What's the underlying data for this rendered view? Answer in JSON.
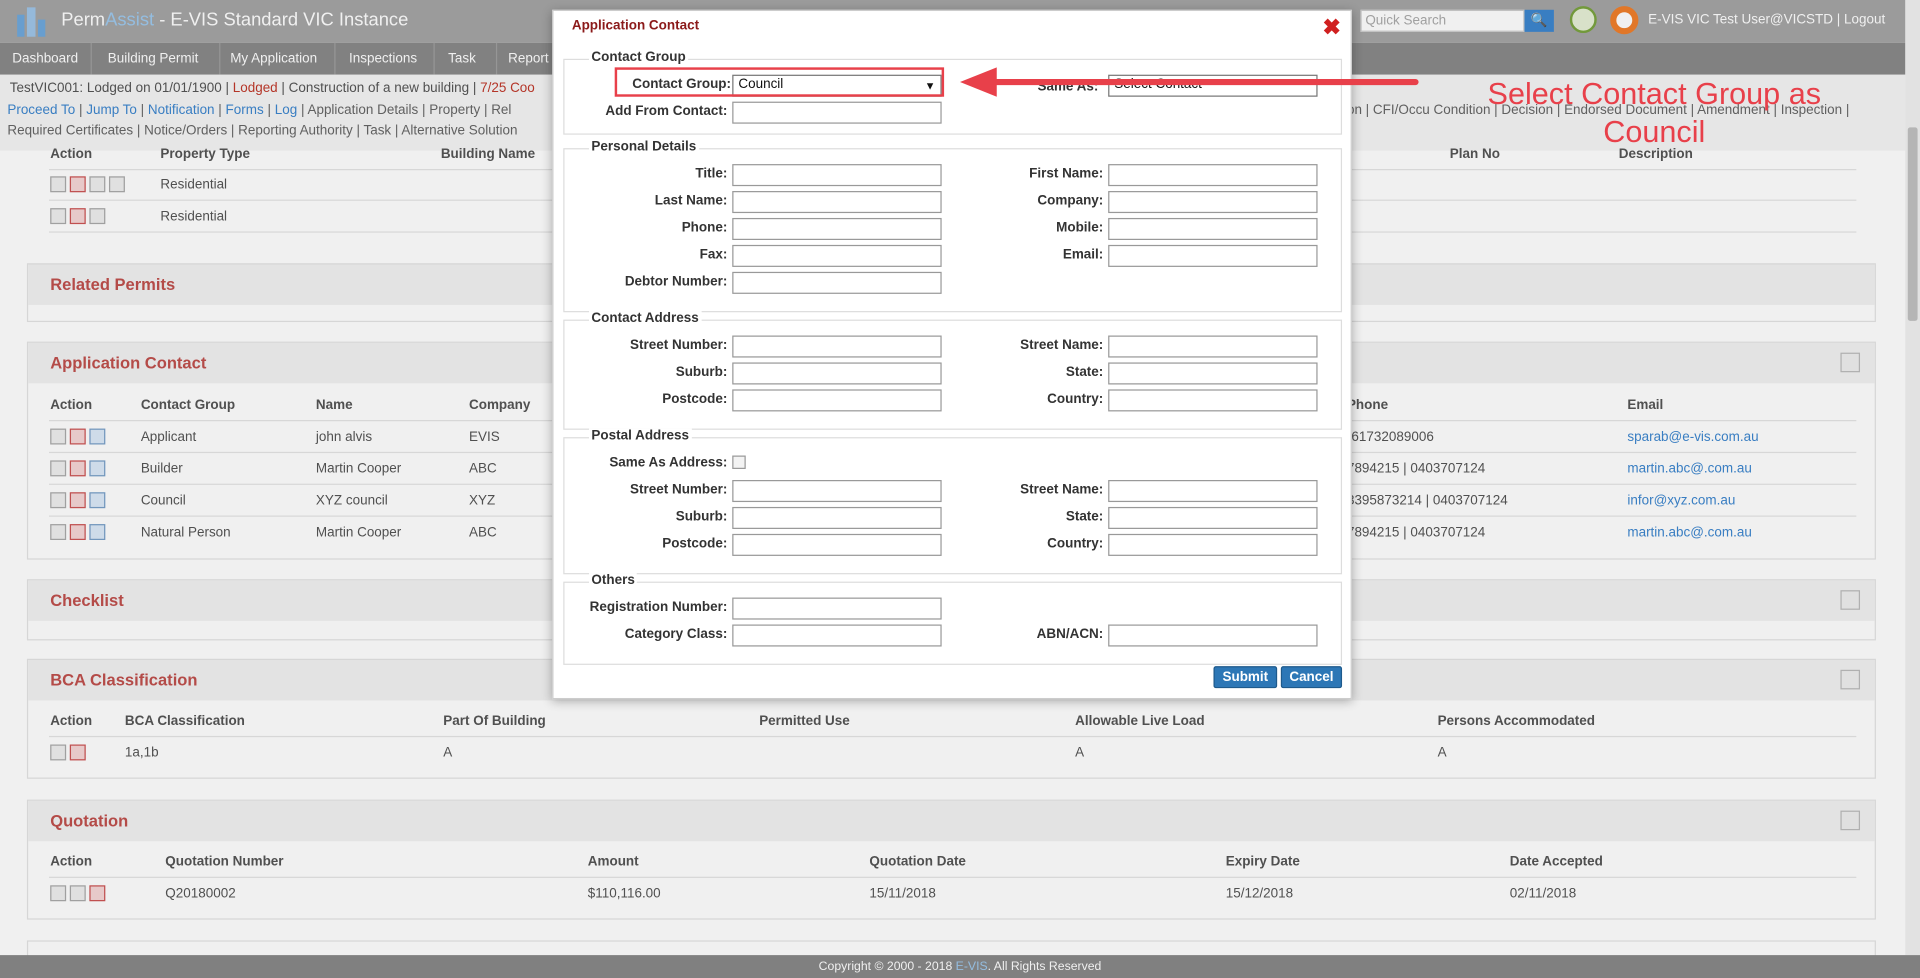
{
  "app": {
    "brand_perm": "Perm",
    "brand_assist": "Assist",
    "title": " - E-VIS Standard VIC Instance"
  },
  "search": {
    "placeholder": "Quick Search",
    "button": "🔍"
  },
  "user": {
    "name": "E-VIS VIC Test User@VICSTD",
    "separator": "|",
    "logout": "Logout"
  },
  "nav": [
    "Dashboard",
    "Building Permit ▸",
    "My Application",
    "Inspections",
    "Task",
    "Report"
  ],
  "info": {
    "line1_a": "TestVIC001: Lodged on 01/01/1900 | ",
    "line1_status": "Lodged",
    "line1_b": " | Construction of a new building | ",
    "line1_c": "7/25 Coo",
    "links": [
      "Proceed To",
      "Jump To",
      "Notification",
      "Forms",
      "Log"
    ],
    "plain": [
      "Application Details",
      "Property",
      "Rel"
    ],
    "right": "on | CFI/Occu Condition | Decision | Endorsed Document | Amendment | Inspection |",
    "line3": "Required Certificates | Notice/Orders | Reporting Authority | Task | Alternative Solution"
  },
  "property_table": {
    "headers": [
      "Action",
      "Property Type",
      "Building Name",
      "Plan No",
      "Description"
    ],
    "rows": [
      [
        "Residential"
      ],
      [
        "Residential"
      ]
    ]
  },
  "sections": {
    "related_permits": "Related Permits",
    "application_contact": "Application Contact",
    "checklist": "Checklist",
    "bca": "BCA Classification",
    "quotation": "Quotation"
  },
  "contacts": {
    "headers": [
      "Action",
      "Contact Group",
      "Name",
      "Company",
      "Phone",
      "Email"
    ],
    "rows": [
      {
        "group": "Applicant",
        "name": "john alvis",
        "company": "EVIS",
        "phone": "-61732089006",
        "email": "sparab@e-vis.com.au"
      },
      {
        "group": "Builder",
        "name": "Martin Cooper",
        "company": "ABC",
        "phone": "7894215 | 0403707124",
        "email": "martin.abc@.com.au"
      },
      {
        "group": "Council",
        "name": "XYZ council",
        "company": "XYZ",
        "phone": "3395873214 | 0403707124",
        "email": "infor@xyz.com.au"
      },
      {
        "group": "Natural Person",
        "name": "Martin Cooper",
        "company": "ABC",
        "phone": "7894215 | 0403707124",
        "email": "martin.abc@.com.au"
      }
    ]
  },
  "bca_table": {
    "headers": [
      "Action",
      "BCA Classification",
      "Part Of Building",
      "Permitted Use",
      "Allowable Live Load",
      "Persons Accommodated"
    ],
    "row": [
      "1a,1b",
      "A",
      "",
      "A",
      "A"
    ]
  },
  "quotation_table": {
    "headers": [
      "Action",
      "Quotation Number",
      "Amount",
      "Quotation Date",
      "Expiry Date",
      "Date Accepted"
    ],
    "row": [
      "Q20180002",
      "$110,116.00",
      "15/11/2018",
      "15/12/2018",
      "02/11/2018"
    ]
  },
  "footer": {
    "a": "Copyright © 2000 - 2018 ",
    "b": "E-VIS",
    "c": ". All Rights Reserved"
  },
  "modal": {
    "title": "Application Contact",
    "close": "✖",
    "contact_group": {
      "legend": "Contact Group",
      "label": "Contact Group:",
      "value": "Council",
      "same_as_label": "Same As:",
      "same_as_value": "Select Contact",
      "add_from_label": "Add From Contact:"
    },
    "personal": {
      "legend": "Personal Details",
      "title": "Title:",
      "first_name": "First Name:",
      "last_name": "Last Name:",
      "company": "Company:",
      "phone": "Phone:",
      "mobile": "Mobile:",
      "fax": "Fax:",
      "email": "Email:",
      "debtor": "Debtor Number:"
    },
    "address": {
      "legend": "Contact Address",
      "street_number": "Street Number:",
      "street_name": "Street Name:",
      "suburb": "Suburb:",
      "state": "State:",
      "postcode": "Postcode:",
      "country": "Country:"
    },
    "postal": {
      "legend": "Postal Address",
      "same_as_address": "Same As Address:",
      "street_number": "Street Number:",
      "street_name": "Street Name:",
      "suburb": "Suburb:",
      "state": "State:",
      "postcode": "Postcode:",
      "country": "Country:"
    },
    "others": {
      "legend": "Others",
      "registration": "Registration Number:",
      "category": "Category Class:",
      "abn": "ABN/ACN:"
    },
    "submit": "Submit",
    "cancel": "Cancel"
  },
  "annotation": {
    "line1": "Select Contact Group as",
    "line2": "Council",
    "color": "#e8404a"
  }
}
